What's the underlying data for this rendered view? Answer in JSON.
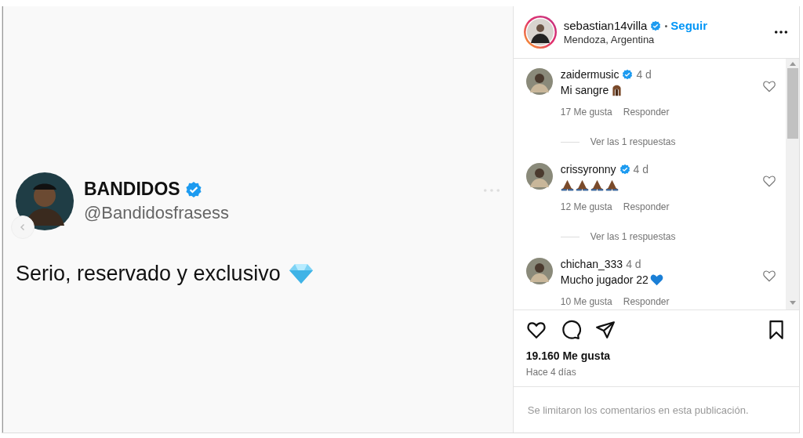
{
  "post": {
    "author": {
      "name": "BANDIDOS",
      "verified": true,
      "handle": "@Bandidosfrasess"
    },
    "text": "Serio, reservado y exclusivo",
    "emoji": [
      {
        "kind": "diamond"
      }
    ]
  },
  "header": {
    "username": "sebastian14villa",
    "verified": true,
    "separator": "•",
    "follow": "Seguir",
    "location": "Mendoza, Argentina"
  },
  "comments": [
    {
      "username": "zaidermusic",
      "verified": true,
      "time": "4 d",
      "text": "Mi sangre",
      "emoji": [
        {
          "kind": "hands"
        }
      ],
      "likes": "17 Me gusta",
      "reply": "Responder",
      "replies": "Ver las 1 respuestas",
      "liked": false
    },
    {
      "username": "crissyronny",
      "verified": true,
      "time": "4 d",
      "emoji": [
        {
          "kind": "pray"
        },
        {
          "kind": "pray"
        },
        {
          "kind": "pray"
        },
        {
          "kind": "pray"
        }
      ],
      "likes": "12 Me gusta",
      "reply": "Responder",
      "replies": "Ver las 1 respuestas",
      "liked": false
    },
    {
      "username": "chichan_333",
      "verified": false,
      "time": "4 d",
      "text": "Mucho jugador 22",
      "emoji": [
        {
          "kind": "blue-heart"
        }
      ],
      "likes": "10 Me gusta",
      "reply": "Responder",
      "liked": false
    }
  ],
  "likes": "19.160 Me gusta",
  "date": "Hace 4 días",
  "footer": "Se limitaron los comentarios en esta publicación."
}
